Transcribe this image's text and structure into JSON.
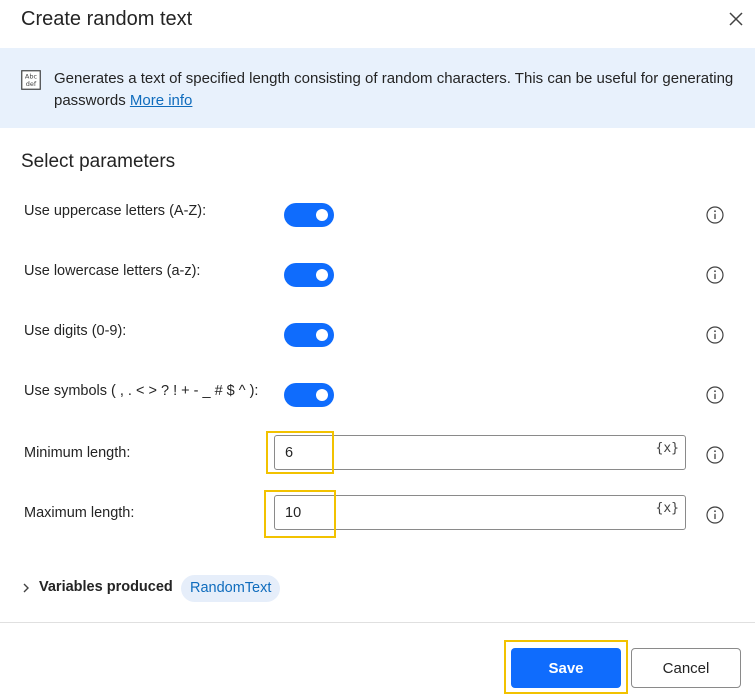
{
  "dialog": {
    "title": "Create random text"
  },
  "banner": {
    "text": "Generates a text of specified length consisting of random characters. This can be useful for generating passwords",
    "link": "More info"
  },
  "section_title": "Select parameters",
  "params": {
    "uppercase": {
      "label": "Use uppercase letters (A-Z):",
      "on": true
    },
    "lowercase": {
      "label": "Use lowercase letters (a-z):",
      "on": true
    },
    "digits": {
      "label": "Use digits (0-9):",
      "on": true
    },
    "symbols": {
      "label": "Use symbols ( , . < > ? ! + - _ # $ ^ ):",
      "on": true
    },
    "min_length": {
      "label": "Minimum length:",
      "value": "6"
    },
    "max_length": {
      "label": "Maximum length:",
      "value": "10"
    },
    "var_picker": "{x}"
  },
  "variables": {
    "label": "Variables produced",
    "items": [
      "RandomText"
    ]
  },
  "footer": {
    "save_label": "Save",
    "cancel_label": "Cancel"
  },
  "colors": {
    "accent": "#0f6cfd",
    "banner_bg": "#e8f1fc",
    "highlight": "#f2c200",
    "link": "#0f6cbd"
  }
}
